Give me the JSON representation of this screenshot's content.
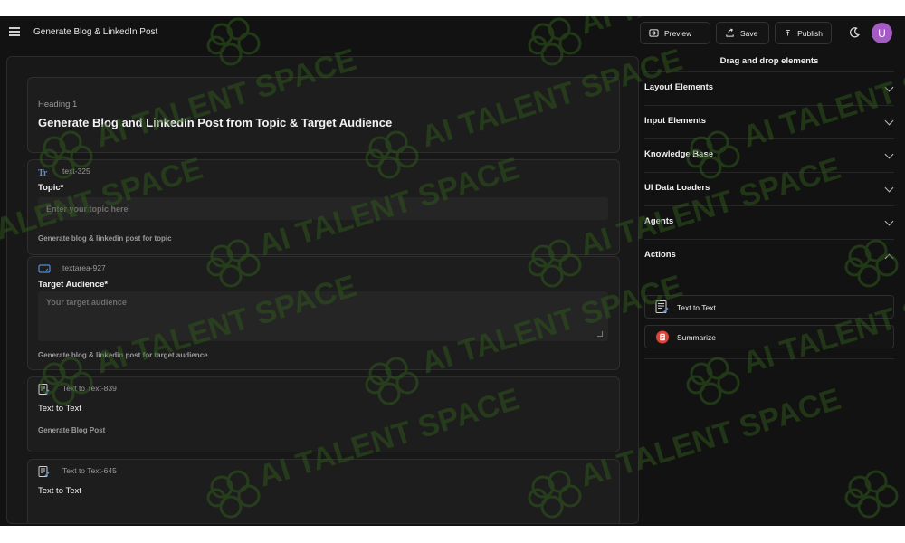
{
  "header": {
    "title": "Generate Blog & LinkedIn Post",
    "preview_label": "Preview",
    "save_label": "Save",
    "publish_label": "Publish",
    "avatar_initial": "U"
  },
  "canvas": {
    "heading_block": {
      "label": "Heading 1",
      "text": "Generate Blog and LinkedIn Post from Topic & Target Audience"
    },
    "topic_block": {
      "id": "text-325",
      "label": "Topic*",
      "placeholder": "Enter your topic here",
      "help": "Generate blog & linkedin post for topic"
    },
    "audience_block": {
      "id": "textarea-927",
      "label": "Target Audience*",
      "placeholder": "Your target audience",
      "help": "Generate blog & linkedin post for target audience"
    },
    "tt1_block": {
      "id": "Text to Text-839",
      "label": "Text to Text",
      "help": "Generate Blog Post"
    },
    "tt2_block": {
      "id": "Text to Text-645",
      "label": "Text to Text"
    }
  },
  "panel": {
    "title": "Drag and drop elements",
    "sections": [
      {
        "label": "Layout Elements",
        "expanded": false
      },
      {
        "label": "Input Elements",
        "expanded": false
      },
      {
        "label": "Knowledge Base",
        "expanded": false
      },
      {
        "label": "UI Data Loaders",
        "expanded": false
      },
      {
        "label": "Agents",
        "expanded": false
      },
      {
        "label": "Actions",
        "expanded": true
      }
    ],
    "actions": [
      {
        "label": "Text to Text",
        "icon": "text-to-text-icon"
      },
      {
        "label": "Summarize",
        "icon": "summarize-icon"
      }
    ]
  },
  "watermark": {
    "text": "AI TALENT SPACE"
  },
  "colors": {
    "background": "#121212",
    "card": "#1d1d1d",
    "avatar": "#a45cc4",
    "accent_blue": "#4f8fd8",
    "watermark": "#2f5a1c"
  }
}
